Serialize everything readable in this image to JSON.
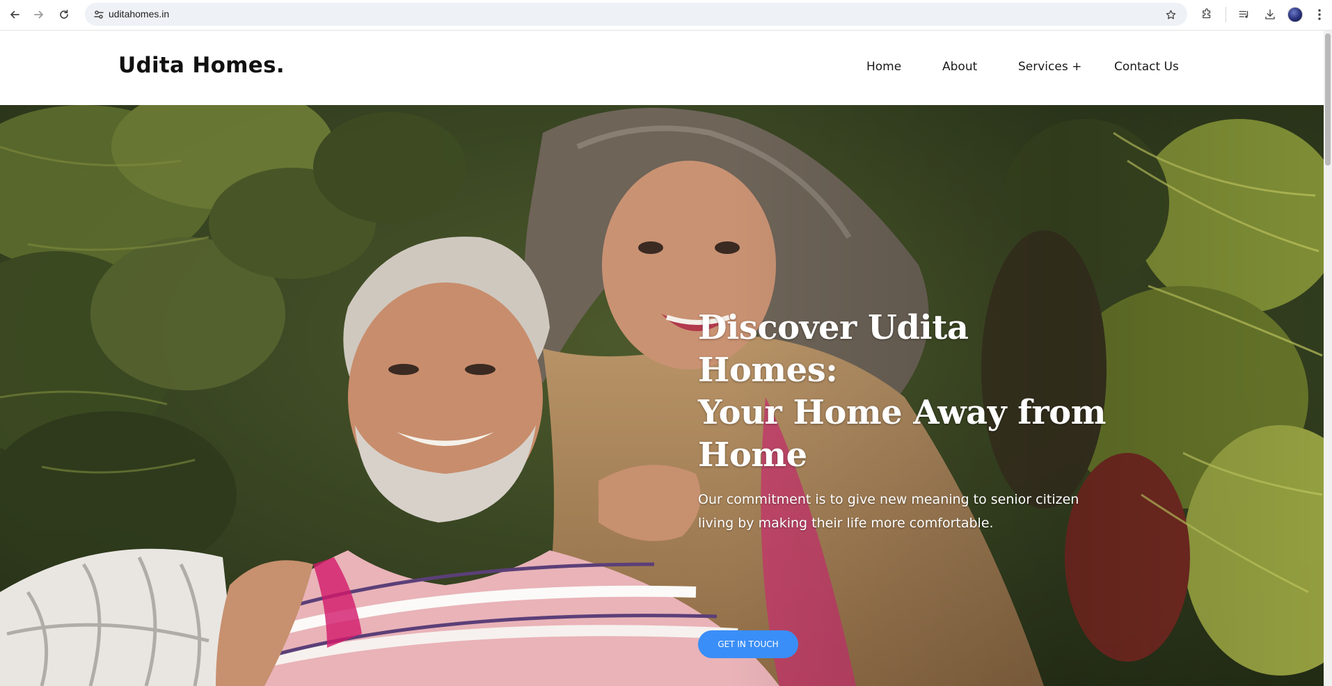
{
  "browser": {
    "url": "uditahomes.in",
    "icons": {
      "back": "back-arrow-icon",
      "forward": "forward-arrow-icon",
      "reload": "reload-icon",
      "site_info": "tune-icon",
      "bookmark": "star-icon",
      "extensions": "puzzle-icon",
      "media": "media-controls-icon",
      "downloads": "download-icon",
      "profile": "avatar-icon",
      "menu": "kebab-menu-icon"
    }
  },
  "site": {
    "logo": "Udita Homes.",
    "nav": [
      {
        "label": "Home"
      },
      {
        "label": "About"
      },
      {
        "label": "Services +"
      },
      {
        "label": "Contact Us"
      }
    ]
  },
  "hero": {
    "title_line1": "Discover Udita Homes:",
    "title_line2": "Your Home Away from",
    "title_line3": "Home",
    "subtitle": "Our commitment is to give new meaning to senior citizen living by making their life more comfortable.",
    "cta_label": "GET IN TOUCH",
    "image_description_colors": {
      "foliage_dark": "#2f3a1c",
      "foliage_light": "#8a9a3a",
      "accent_button": "#3a8ef7"
    }
  }
}
